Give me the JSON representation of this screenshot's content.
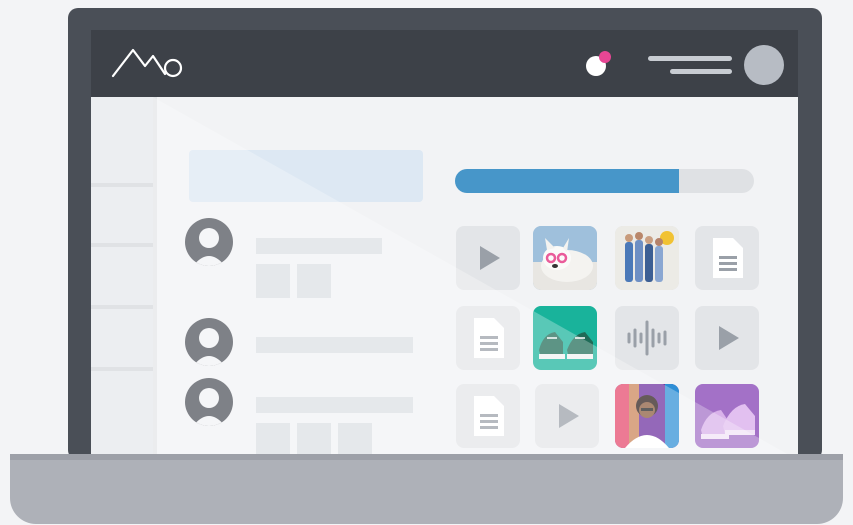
{
  "app": {
    "logo_icon": "mountain-logo-icon"
  },
  "topbar": {
    "notification_icon": "notification-dot-icon",
    "menu_icon": "hamburger-menu-icon",
    "avatar_icon": "user-avatar-icon"
  },
  "upload": {
    "progress": 0.75,
    "color": "#4796c9"
  },
  "colors": {
    "accent": "#4796c9",
    "notification": "#e74694",
    "bezel": "#4a4f57",
    "topbar": "#3d4148"
  },
  "media_grid": [
    [
      "play-icon",
      "photo-dog",
      "photo-group",
      "document-icon"
    ],
    [
      "document-icon",
      "photo-sneakers-green",
      "audio-wave-icon",
      "play-icon"
    ],
    [
      "document-icon",
      "play-icon",
      "photo-person",
      "photo-sneakers-purple"
    ]
  ],
  "list_items": [
    {
      "avatar": "user-avatar-icon",
      "sub_blocks": 2
    },
    {
      "avatar": "user-avatar-icon",
      "sub_blocks": 0
    },
    {
      "avatar": "user-avatar-icon",
      "sub_blocks": 3
    }
  ]
}
